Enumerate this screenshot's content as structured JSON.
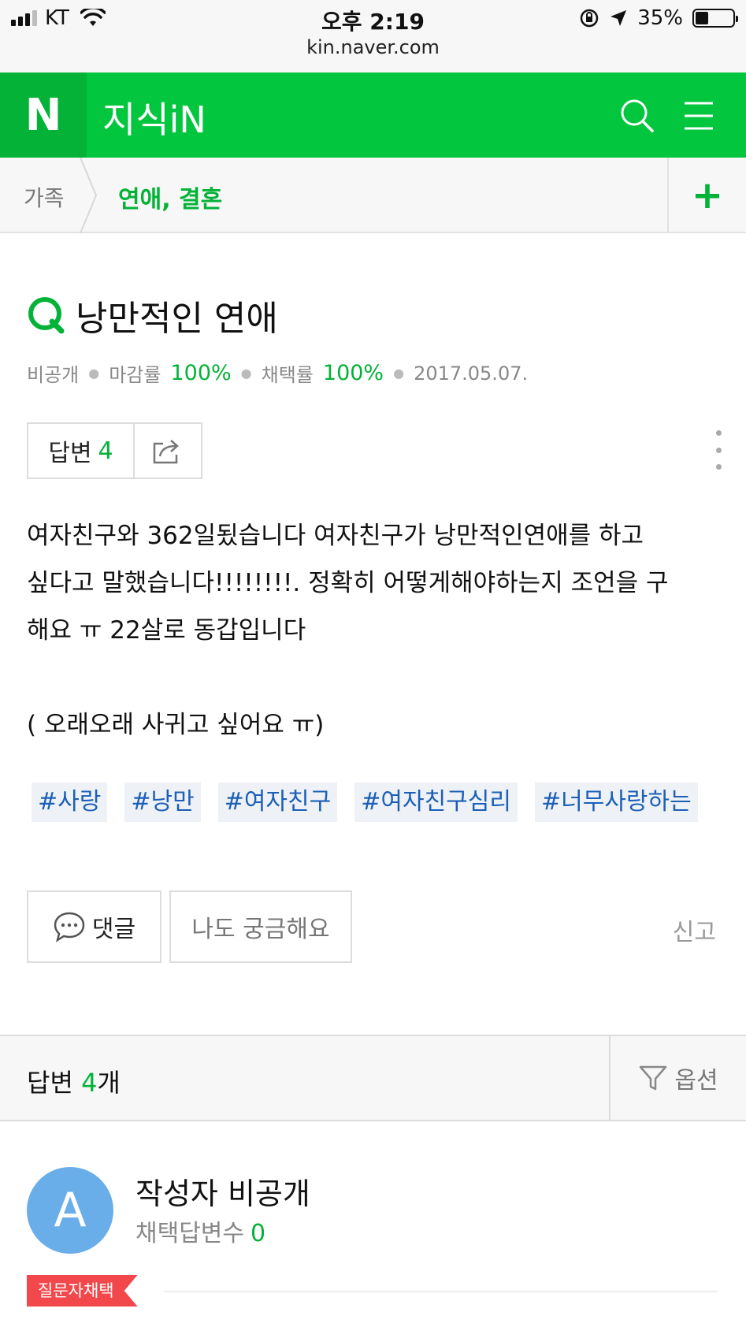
{
  "status_bar": {
    "carrier": "KT",
    "time": "오후 2:19",
    "battery": "35%",
    "battery_level": 0.35,
    "url": "kin.naver.com"
  },
  "header": {
    "logo": "N",
    "brand": "지식iN",
    "icons": [
      "search-icon",
      "menu-icon"
    ]
  },
  "breadcrumb": {
    "parent": "가족",
    "current": "연애, 결혼",
    "add": "+"
  },
  "question": {
    "title": "낭만적인 연애",
    "author": "비공개",
    "close_rate_label": "마감률",
    "close_rate": "100%",
    "adopt_rate_label": "채택률",
    "adopt_rate": "100%",
    "date": "2017.05.07.",
    "answer_label": "답변",
    "answer_count": "4",
    "body_line1": "여자친구와 362일됬습니다 여자친구가 낭만적인연애를 하고",
    "body_line2": "싶다고 말했습니다!!!!!!!!. 정확히 어떻게해야하는지 조언을 구",
    "body_line3": "해요 ㅠ 22살로 동갑입니다",
    "body_line4": "( 오래오래 사귀고 싶어요 ㅠ)",
    "tags": [
      "#사랑",
      "#낭만",
      "#여자친구",
      "#여자친구심리",
      "#너무사랑하는"
    ]
  },
  "actions": {
    "comment": "댓글",
    "curious": "나도 궁금해요",
    "report": "신고"
  },
  "answers": {
    "label": "답변",
    "count": "4",
    "unit": "개",
    "option": "옵션"
  },
  "answer_card": {
    "avatar_letter": "A",
    "author": "작성자 비공개",
    "adopted_label": "채택답변수",
    "adopted_count": "0",
    "badge": "질문자채택"
  },
  "colors": {
    "naver_green": "#03c63f",
    "accent_green": "#03b237",
    "tag_blue": "#1b5fb8",
    "badge_red": "#f2484b",
    "avatar_blue": "#6aaee9"
  }
}
